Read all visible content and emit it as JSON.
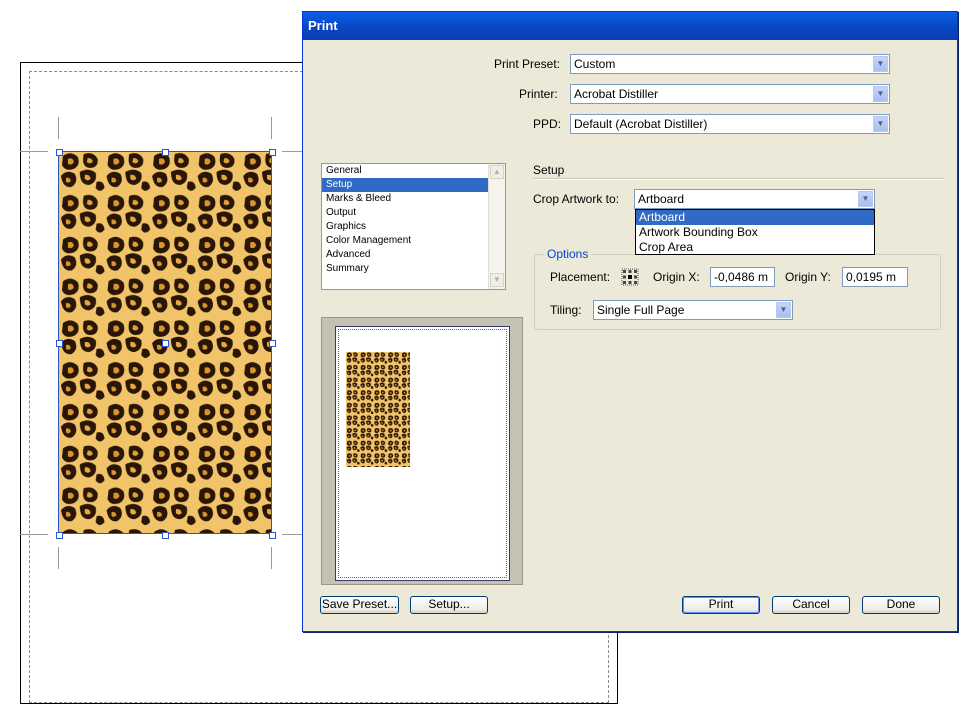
{
  "dialog": {
    "title": "Print",
    "print_preset": {
      "label": "Print Preset:",
      "value": "Custom"
    },
    "printer": {
      "label": "Printer:",
      "value": "Acrobat Distiller"
    },
    "ppd": {
      "label": "PPD:",
      "value": "Default (Acrobat Distiller)"
    },
    "categories": [
      "General",
      "Setup",
      "Marks & Bleed",
      "Output",
      "Graphics",
      "Color Management",
      "Advanced",
      "Summary"
    ],
    "selected_category": "Setup",
    "setup": {
      "section_title": "Setup",
      "crop_label": "Crop Artwork to:",
      "crop_value": "Artboard",
      "crop_options": [
        "Artboard",
        "Artwork Bounding Box",
        "Crop Area"
      ],
      "options_label": "Options",
      "placement_label": "Placement:",
      "origin_x_label": "Origin X:",
      "origin_x_value": "-0,0486 m",
      "origin_y_label": "Origin Y:",
      "origin_y_value": "0,0195 m",
      "tiling_label": "Tiling:",
      "tiling_value": "Single Full Page"
    },
    "buttons": {
      "save_preset": "Save Preset...",
      "setup": "Setup...",
      "print": "Print",
      "cancel": "Cancel",
      "done": "Done"
    }
  },
  "colors": {
    "title_bar": "#0a5fe8",
    "dialog_bg": "#ece9d8",
    "selection": "#316ac5",
    "options_label": "#0046d5"
  }
}
